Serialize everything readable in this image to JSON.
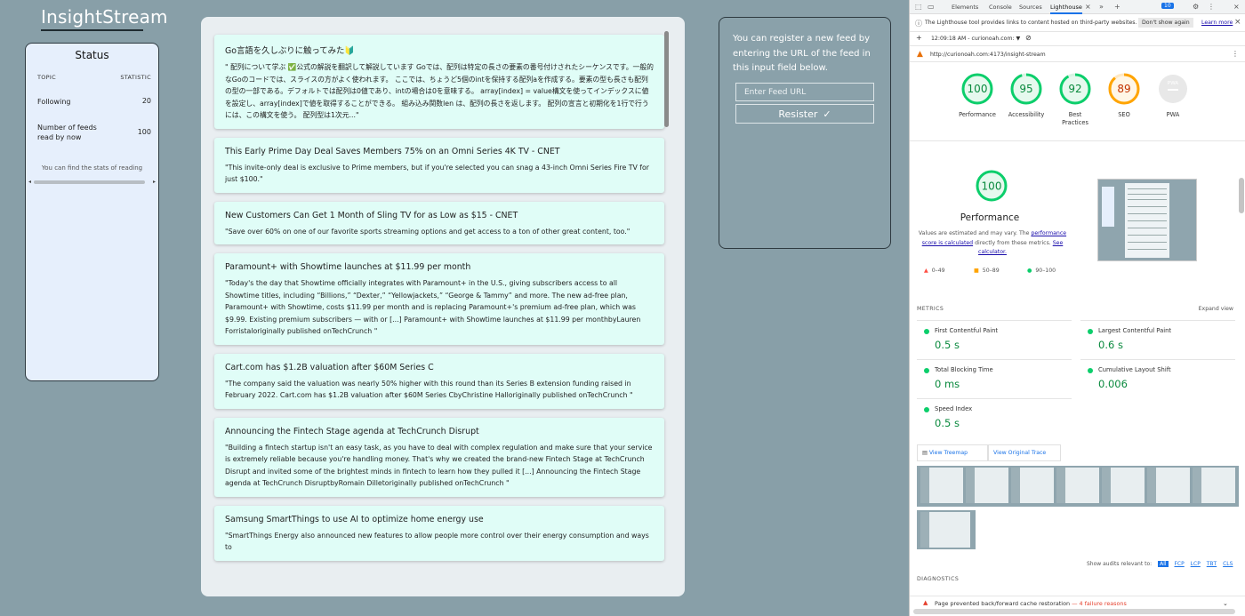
{
  "app": {
    "logo": "InsightStream"
  },
  "status": {
    "title": "Status",
    "col_topic": "TOPIC",
    "col_statistic": "STATISTIC",
    "rows": [
      {
        "label": "Following",
        "value": "20"
      },
      {
        "label": "Number of feeds read by now",
        "value": "100"
      }
    ],
    "note": "You can find the stats of reading"
  },
  "feeds": [
    {
      "title": "Go言語を久しぶりに触ってみた🔰",
      "body": "\" 配列について学ぶ ✅公式の解説を翻訳して解説しています Goでは、配列は特定の長さの要素の番号付けされたシーケンスです。一般的なGoのコードでは、スライスの方がよく使われます。 ここでは、ちょうど5個のintを保持する配列aを作成する。要素の型も長さも配列の型の一部である。デフォルトでは配列は0値であり、intの場合は0を意味する。 array[index] = value構文を使ってインデックスに値を設定し、array[index]で値を取得することができる。 組み込み関数len は、配列の長さを返します。 配列の宣言と初期化を1行で行うには、この構文を使う。 配列型は1次元...\""
    },
    {
      "title": "This Early Prime Day Deal Saves Members 75% on an Omni Series 4K TV - CNET",
      "body": "\"This invite-only deal is exclusive to Prime members, but if you're selected you can snag a 43-inch Omni Series Fire TV for just $100.\""
    },
    {
      "title": "New Customers Can Get 1 Month of Sling TV for as Low as $15 - CNET",
      "body": "\"Save over 60% on one of our favorite sports streaming options and get access to a ton of other great content, too.\""
    },
    {
      "title": "Paramount+ with Showtime launches at $11.99 per month",
      "body": "\"Today's the day that Showtime officially integrates with Paramount+ in the U.S., giving subscribers access to all Showtime titles, including “Billions,” “Dexter,” “Yellowjackets,” “George & Tammy” and more. The new ad-free plan, Paramount+ with Showtime, costs $11.99 per month and is replacing Paramount+'s premium ad-free plan, which was $9.99. Existing premium subscribers — with or [...] Paramount+ with Showtime launches at $11.99 per monthbyLauren Forristaloriginally published onTechCrunch \""
    },
    {
      "title": "Cart.com has $1.2B valuation after $60M Series C",
      "body": "\"The company said the valuation was nearly 50% higher with this round than its Series B extension funding raised in February 2022. Cart.com has $1.2B valuation after $60M Series CbyChristine Halloriginally published onTechCrunch \""
    },
    {
      "title": "Announcing the Fintech Stage agenda at TechCrunch Disrupt",
      "body": "\"Building a fintech startup isn't an easy task, as you have to deal with complex regulation and make sure that your service is extremely reliable because you're handling money. That's why we created the brand-new Fintech Stage at TechCrunch Disrupt and invited some of the brightest minds in fintech to learn how they pulled it [...] Announcing the Fintech Stage agenda at TechCrunch DisruptbyRomain Dilletoriginally published onTechCrunch \""
    },
    {
      "title": "Samsung SmartThings to use AI to optimize home energy use",
      "body": "\"SmartThings Energy also announced new features to allow people more control over their energy consumption and ways to"
    }
  ],
  "register": {
    "description": "You can register a new feed by entering the URL of the feed in this input field below.",
    "input_placeholder": "Enter Feed URL",
    "button_label": "Resister"
  },
  "devtools": {
    "tabs": [
      "Elements",
      "Console",
      "Sources",
      "Lighthouse"
    ],
    "issues_count": "10",
    "info_text": "The Lighthouse tool provides links to content hosted on third-party websites.",
    "dont_show": "Don't show again",
    "learn_more": "Learn more",
    "report_time": "12:09:18 AM - curionoah.com: ▼",
    "url": "http://curionoah.com:4173/insight-stream",
    "scores": [
      {
        "label": "Performance",
        "score": "100",
        "value": 100,
        "color": "#0cce6b"
      },
      {
        "label": "Accessibility",
        "score": "95",
        "value": 95,
        "color": "#0cce6b"
      },
      {
        "label": "Best Practices",
        "score": "92",
        "value": 92,
        "color": "#0cce6b"
      },
      {
        "label": "SEO",
        "score": "89",
        "value": 89,
        "color": "#ffa400"
      },
      {
        "label": "PWA",
        "score": "PWA",
        "value": 0,
        "color": "#cccccc"
      }
    ],
    "perf_score": "100",
    "perf_title": "Performance",
    "perf_desc_1": "Values are estimated and may vary. The ",
    "perf_desc_link1": "performance score is calculated",
    "perf_desc_2": " directly from these metrics. ",
    "perf_desc_link2": "See calculator.",
    "legend": [
      {
        "range": "0–49",
        "symbol": "▲",
        "color": "#ff4e42"
      },
      {
        "range": "50–89",
        "symbol": "■",
        "color": "#ffa400"
      },
      {
        "range": "90–100",
        "symbol": "●",
        "color": "#0cce6b"
      }
    ],
    "metrics_heading": "METRICS",
    "expand_view": "Expand view",
    "metrics": [
      {
        "name": "First Contentful Paint",
        "value": "0.5 s"
      },
      {
        "name": "Largest Contentful Paint",
        "value": "0.6 s"
      },
      {
        "name": "Total Blocking Time",
        "value": "0 ms"
      },
      {
        "name": "Cumulative Layout Shift",
        "value": "0.006"
      },
      {
        "name": "Speed Index",
        "value": "0.5 s"
      }
    ],
    "view_treemap": "View Treemap",
    "view_trace": "View Original Trace",
    "show_audits_label": "Show audits relevant to:",
    "audit_chips": [
      "All",
      "FCP",
      "LCP",
      "TBT",
      "CLS"
    ],
    "diagnostics_heading": "DIAGNOSTICS",
    "diag_text": "Page prevented back/forward cache restoration",
    "diag_detail": "— 4 failure reasons"
  }
}
